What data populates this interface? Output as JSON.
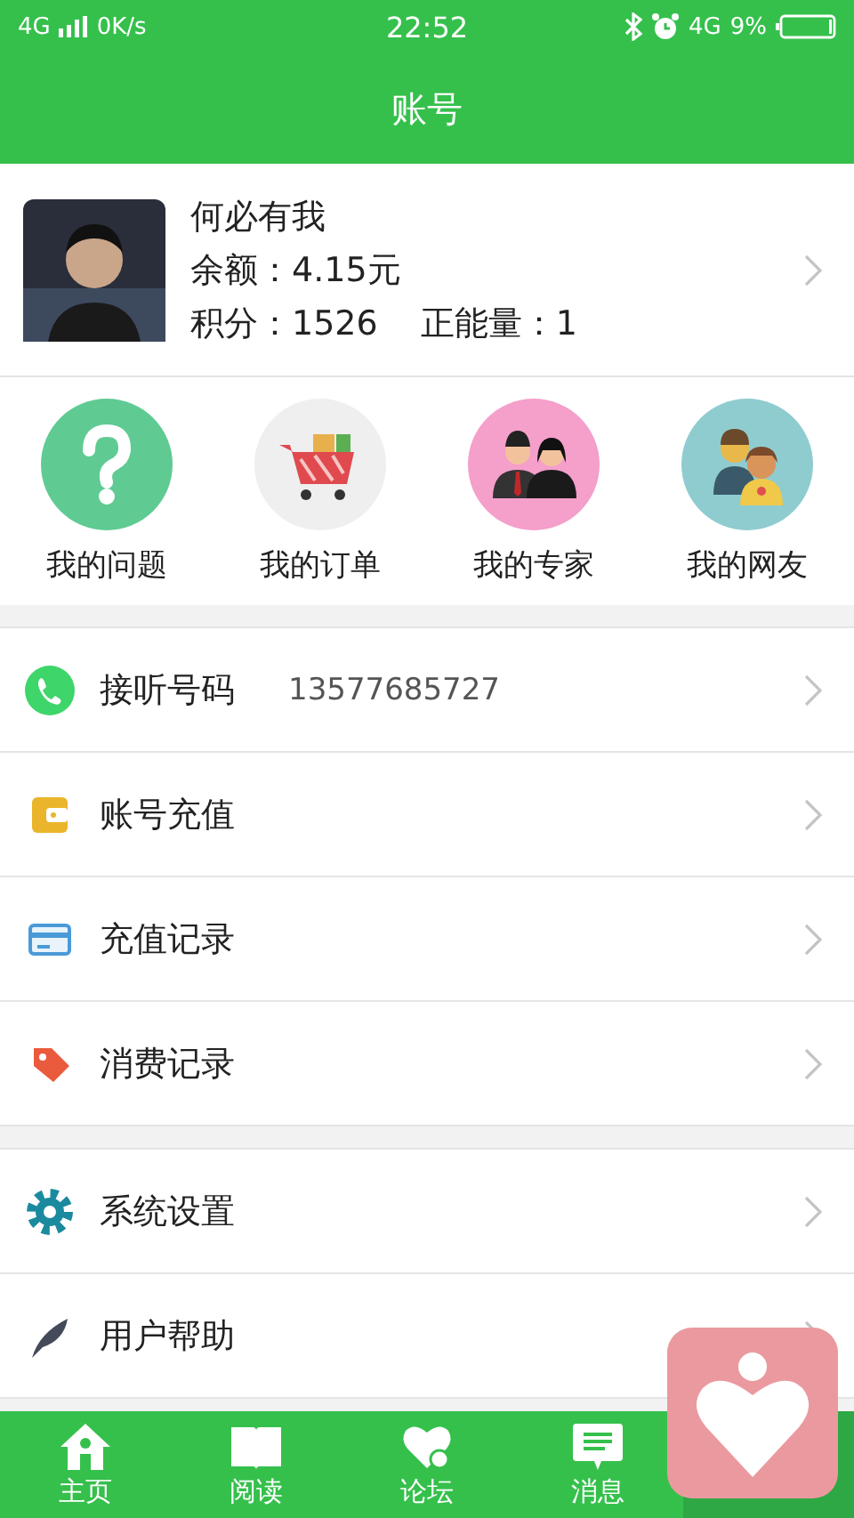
{
  "status_bar": {
    "network": "4G",
    "speed": "0K/s",
    "time": "22:52",
    "network_right": "4G",
    "battery": "9%"
  },
  "header": {
    "title": "账号"
  },
  "profile": {
    "name": "何必有我",
    "balance": "余额：4.15元",
    "points": "积分：1526",
    "energy": "正能量：1"
  },
  "shortcuts": [
    {
      "label": "我的问题"
    },
    {
      "label": "我的订单"
    },
    {
      "label": "我的专家"
    },
    {
      "label": "我的网友"
    }
  ],
  "menu_groups": [
    [
      {
        "label": "接听号码",
        "value": "13577685727"
      },
      {
        "label": "账号充值"
      },
      {
        "label": "充值记录"
      },
      {
        "label": "消费记录"
      }
    ],
    [
      {
        "label": "系统设置"
      },
      {
        "label": "用户帮助"
      }
    ]
  ],
  "bottom_nav": [
    {
      "label": "主页",
      "selected": false
    },
    {
      "label": "阅读",
      "selected": false
    },
    {
      "label": "论坛",
      "selected": false
    },
    {
      "label": "消息",
      "selected": false
    },
    {
      "selected": true
    }
  ]
}
